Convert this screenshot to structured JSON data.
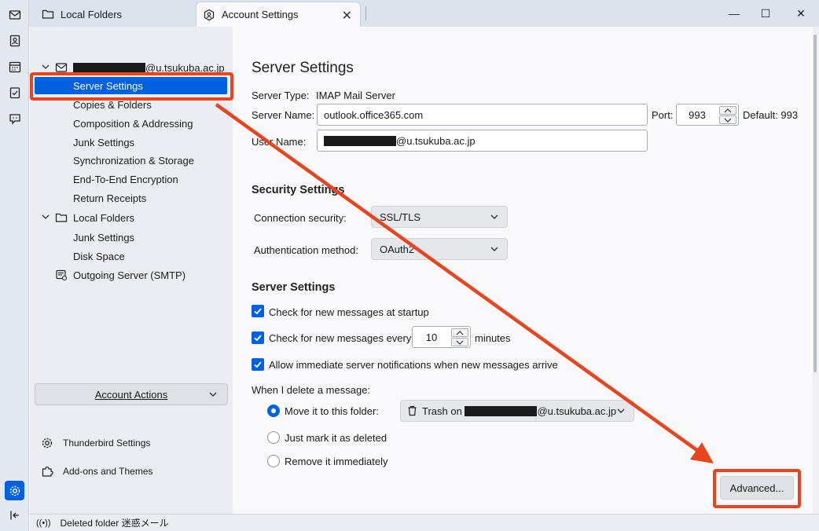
{
  "tabs": [
    {
      "label": "Local Folders",
      "icon": "folder-icon"
    },
    {
      "label": "Account Settings",
      "icon": "account-settings-icon"
    }
  ],
  "window_controls": {
    "minimize": "—",
    "maximize": "☐",
    "close": "✕"
  },
  "spaces": [
    "mail-icon",
    "address-book-icon",
    "calendar-icon",
    "tasks-icon",
    "chat-icon",
    "settings-icon",
    "collapse-icon"
  ],
  "sidebar": {
    "account_email_suffix": "@u.tsukuba.ac.jp",
    "items": [
      {
        "label": "Server Settings"
      },
      {
        "label": "Copies & Folders"
      },
      {
        "label": "Composition & Addressing"
      },
      {
        "label": "Junk Settings"
      },
      {
        "label": "Synchronization & Storage"
      },
      {
        "label": "End-To-End Encryption"
      },
      {
        "label": "Return Receipts"
      },
      {
        "label": "Local Folders"
      },
      {
        "label": "Junk Settings"
      },
      {
        "label": "Disk Space"
      },
      {
        "label": "Outgoing Server (SMTP)"
      }
    ],
    "account_actions": "Account Actions",
    "thunderbird_settings": "Thunderbird Settings",
    "addons": "Add-ons and Themes"
  },
  "main": {
    "title": "Server Settings",
    "server_type_label": "Server Type:",
    "server_type_value": "IMAP Mail Server",
    "server_name_label": "Server Name:",
    "server_name_value": "outlook.office365.com",
    "port_label": "Port:",
    "port_value": "993",
    "default_label": "Default: 993",
    "user_name_label": "User Name:",
    "user_name_suffix": "@u.tsukuba.ac.jp",
    "security_heading": "Security Settings",
    "connection_security_label": "Connection security:",
    "connection_security_value": "SSL/TLS",
    "auth_method_label": "Authentication method:",
    "auth_method_value": "OAuth2",
    "server_settings_heading": "Server Settings",
    "check_startup": "Check for new messages at startup",
    "check_every": "Check for new messages every",
    "check_every_value": "10",
    "minutes": "minutes",
    "allow_notifications": "Allow immediate server notifications when new messages arrive",
    "delete_label": "When I delete a message:",
    "move_to_folder": "Move it to this folder:",
    "trash_prefix": "Trash on",
    "trash_suffix": "@u.tsukuba.ac.jp",
    "just_mark": "Just mark it as deleted",
    "remove_immediately": "Remove it immediately",
    "advanced_button": "Advanced..."
  },
  "status": {
    "text": "Deleted folder 迷惑メール"
  },
  "annotation": {
    "color": "#e8451e"
  }
}
